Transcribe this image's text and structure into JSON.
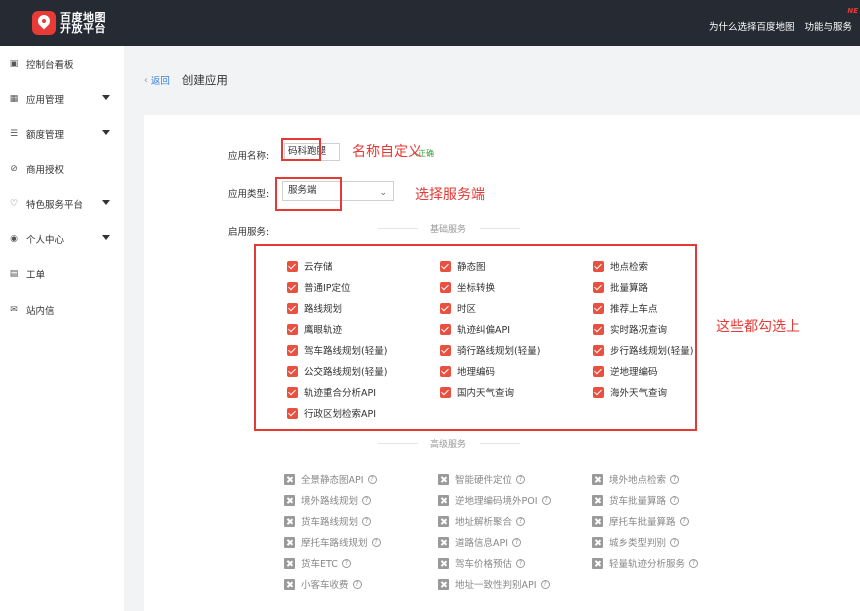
{
  "header": {
    "logo_line1": "百度地图",
    "logo_line2": "开放平台",
    "links": [
      "为什么选择百度地图",
      "功能与服务"
    ],
    "new_tag": "NE"
  },
  "sidebar": {
    "items": [
      {
        "label": "控制台看板",
        "icon": "dashboard-icon",
        "glyph": "▣",
        "has_caret": false
      },
      {
        "label": "应用管理",
        "icon": "app-grid-icon",
        "glyph": "▦",
        "has_caret": true
      },
      {
        "label": "额度管理",
        "icon": "quota-icon",
        "glyph": "☰",
        "has_caret": true
      },
      {
        "label": "商用授权",
        "icon": "shield-check-icon",
        "glyph": "⊘",
        "has_caret": false
      },
      {
        "label": "特色服务平台",
        "icon": "diamond-icon",
        "glyph": "♡",
        "has_caret": true
      },
      {
        "label": "个人中心",
        "icon": "user-icon",
        "glyph": "◉",
        "has_caret": true
      },
      {
        "label": "工单",
        "icon": "ticket-icon",
        "glyph": "▤",
        "has_caret": false
      },
      {
        "label": "站内信",
        "icon": "mail-icon",
        "glyph": "✉",
        "has_caret": false
      }
    ]
  },
  "breadcrumb": {
    "back_label": "返回",
    "title": "创建应用"
  },
  "form": {
    "app_name_label": "应用名称:",
    "app_name_value": "码科跑腿",
    "app_name_hint": "入正确",
    "app_type_label": "应用类型:",
    "app_type_value": "服务端",
    "services_label": "启用服务:"
  },
  "annotations": {
    "name_note": "名称自定义",
    "type_note": "选择服务端",
    "services_note": "这些都勾选上"
  },
  "basic_services": {
    "title": "基础服务",
    "items": [
      [
        "云存储",
        "静态图",
        "地点检索"
      ],
      [
        "普通IP定位",
        "坐标转换",
        "批量算路"
      ],
      [
        "路线规划",
        "时区",
        "推荐上车点"
      ],
      [
        "鹰眼轨迹",
        "轨迹纠偏API",
        "实时路况查询"
      ],
      [
        "驾车路线规划(轻量)",
        "骑行路线规划(轻量)",
        "步行路线规划(轻量)"
      ],
      [
        "公交路线规划(轻量)",
        "地理编码",
        "逆地理编码"
      ],
      [
        "轨迹重合分析API",
        "国内天气查询",
        "海外天气查询"
      ],
      [
        "行政区划检索API"
      ]
    ]
  },
  "advanced_services": {
    "title": "高级服务",
    "help_glyph": "?",
    "items": [
      [
        "全景静态图API",
        "智能硬件定位",
        "境外地点检索"
      ],
      [
        "境外路线规划",
        "逆地理编码境外POI",
        "货车批量算路"
      ],
      [
        "货车路线规划",
        "地址解析聚合",
        "摩托车批量算路"
      ],
      [
        "摩托车路线规划",
        "道路信息API",
        "城乡类型判别"
      ],
      [
        "货车ETC",
        "驾车价格预估",
        "轻量轨迹分析服务"
      ],
      [
        "小客车收费",
        "地址一致性判别API"
      ]
    ]
  },
  "colors": {
    "topbar": "#252a33",
    "accent_red": "#e83b37",
    "checkbox_red": "#e8513f",
    "link_blue": "#3a7fdc"
  }
}
